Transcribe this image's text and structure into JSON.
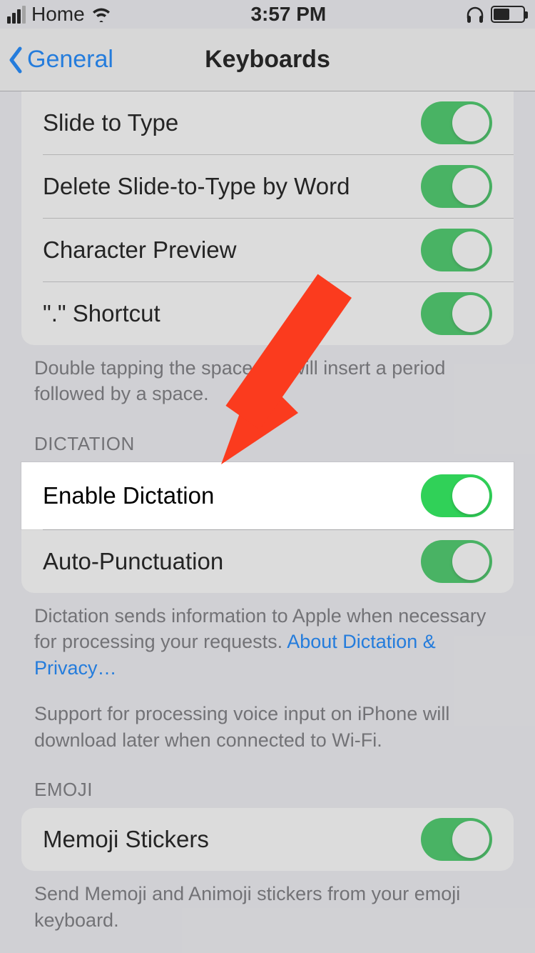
{
  "status": {
    "carrier": "Home",
    "time": "3:57 PM"
  },
  "nav": {
    "back_label": "General",
    "title": "Keyboards"
  },
  "group1": {
    "rows": [
      {
        "label": "Slide to Type",
        "on": true
      },
      {
        "label": "Delete Slide-to-Type by Word",
        "on": true
      },
      {
        "label": "Character Preview",
        "on": true
      },
      {
        "label": "\".\" Shortcut",
        "on": true
      }
    ],
    "footer": "Double tapping the space bar will insert a period followed by a space."
  },
  "dictation": {
    "header": "DICTATION",
    "rows": [
      {
        "label": "Enable Dictation",
        "on": true,
        "highlight": true
      },
      {
        "label": "Auto-Punctuation",
        "on": true
      }
    ],
    "footer1_a": "Dictation sends information to Apple when necessary for processing your requests. ",
    "footer1_link": "About Dictation & Privacy…",
    "footer2": "Support for processing voice input on iPhone will download later when connected to Wi-Fi."
  },
  "emoji": {
    "header": "EMOJI",
    "rows": [
      {
        "label": "Memoji Stickers",
        "on": true
      }
    ],
    "footer": "Send Memoji and Animoji stickers from your emoji keyboard."
  },
  "annotation": {
    "arrow_color": "#fb3b1e"
  }
}
